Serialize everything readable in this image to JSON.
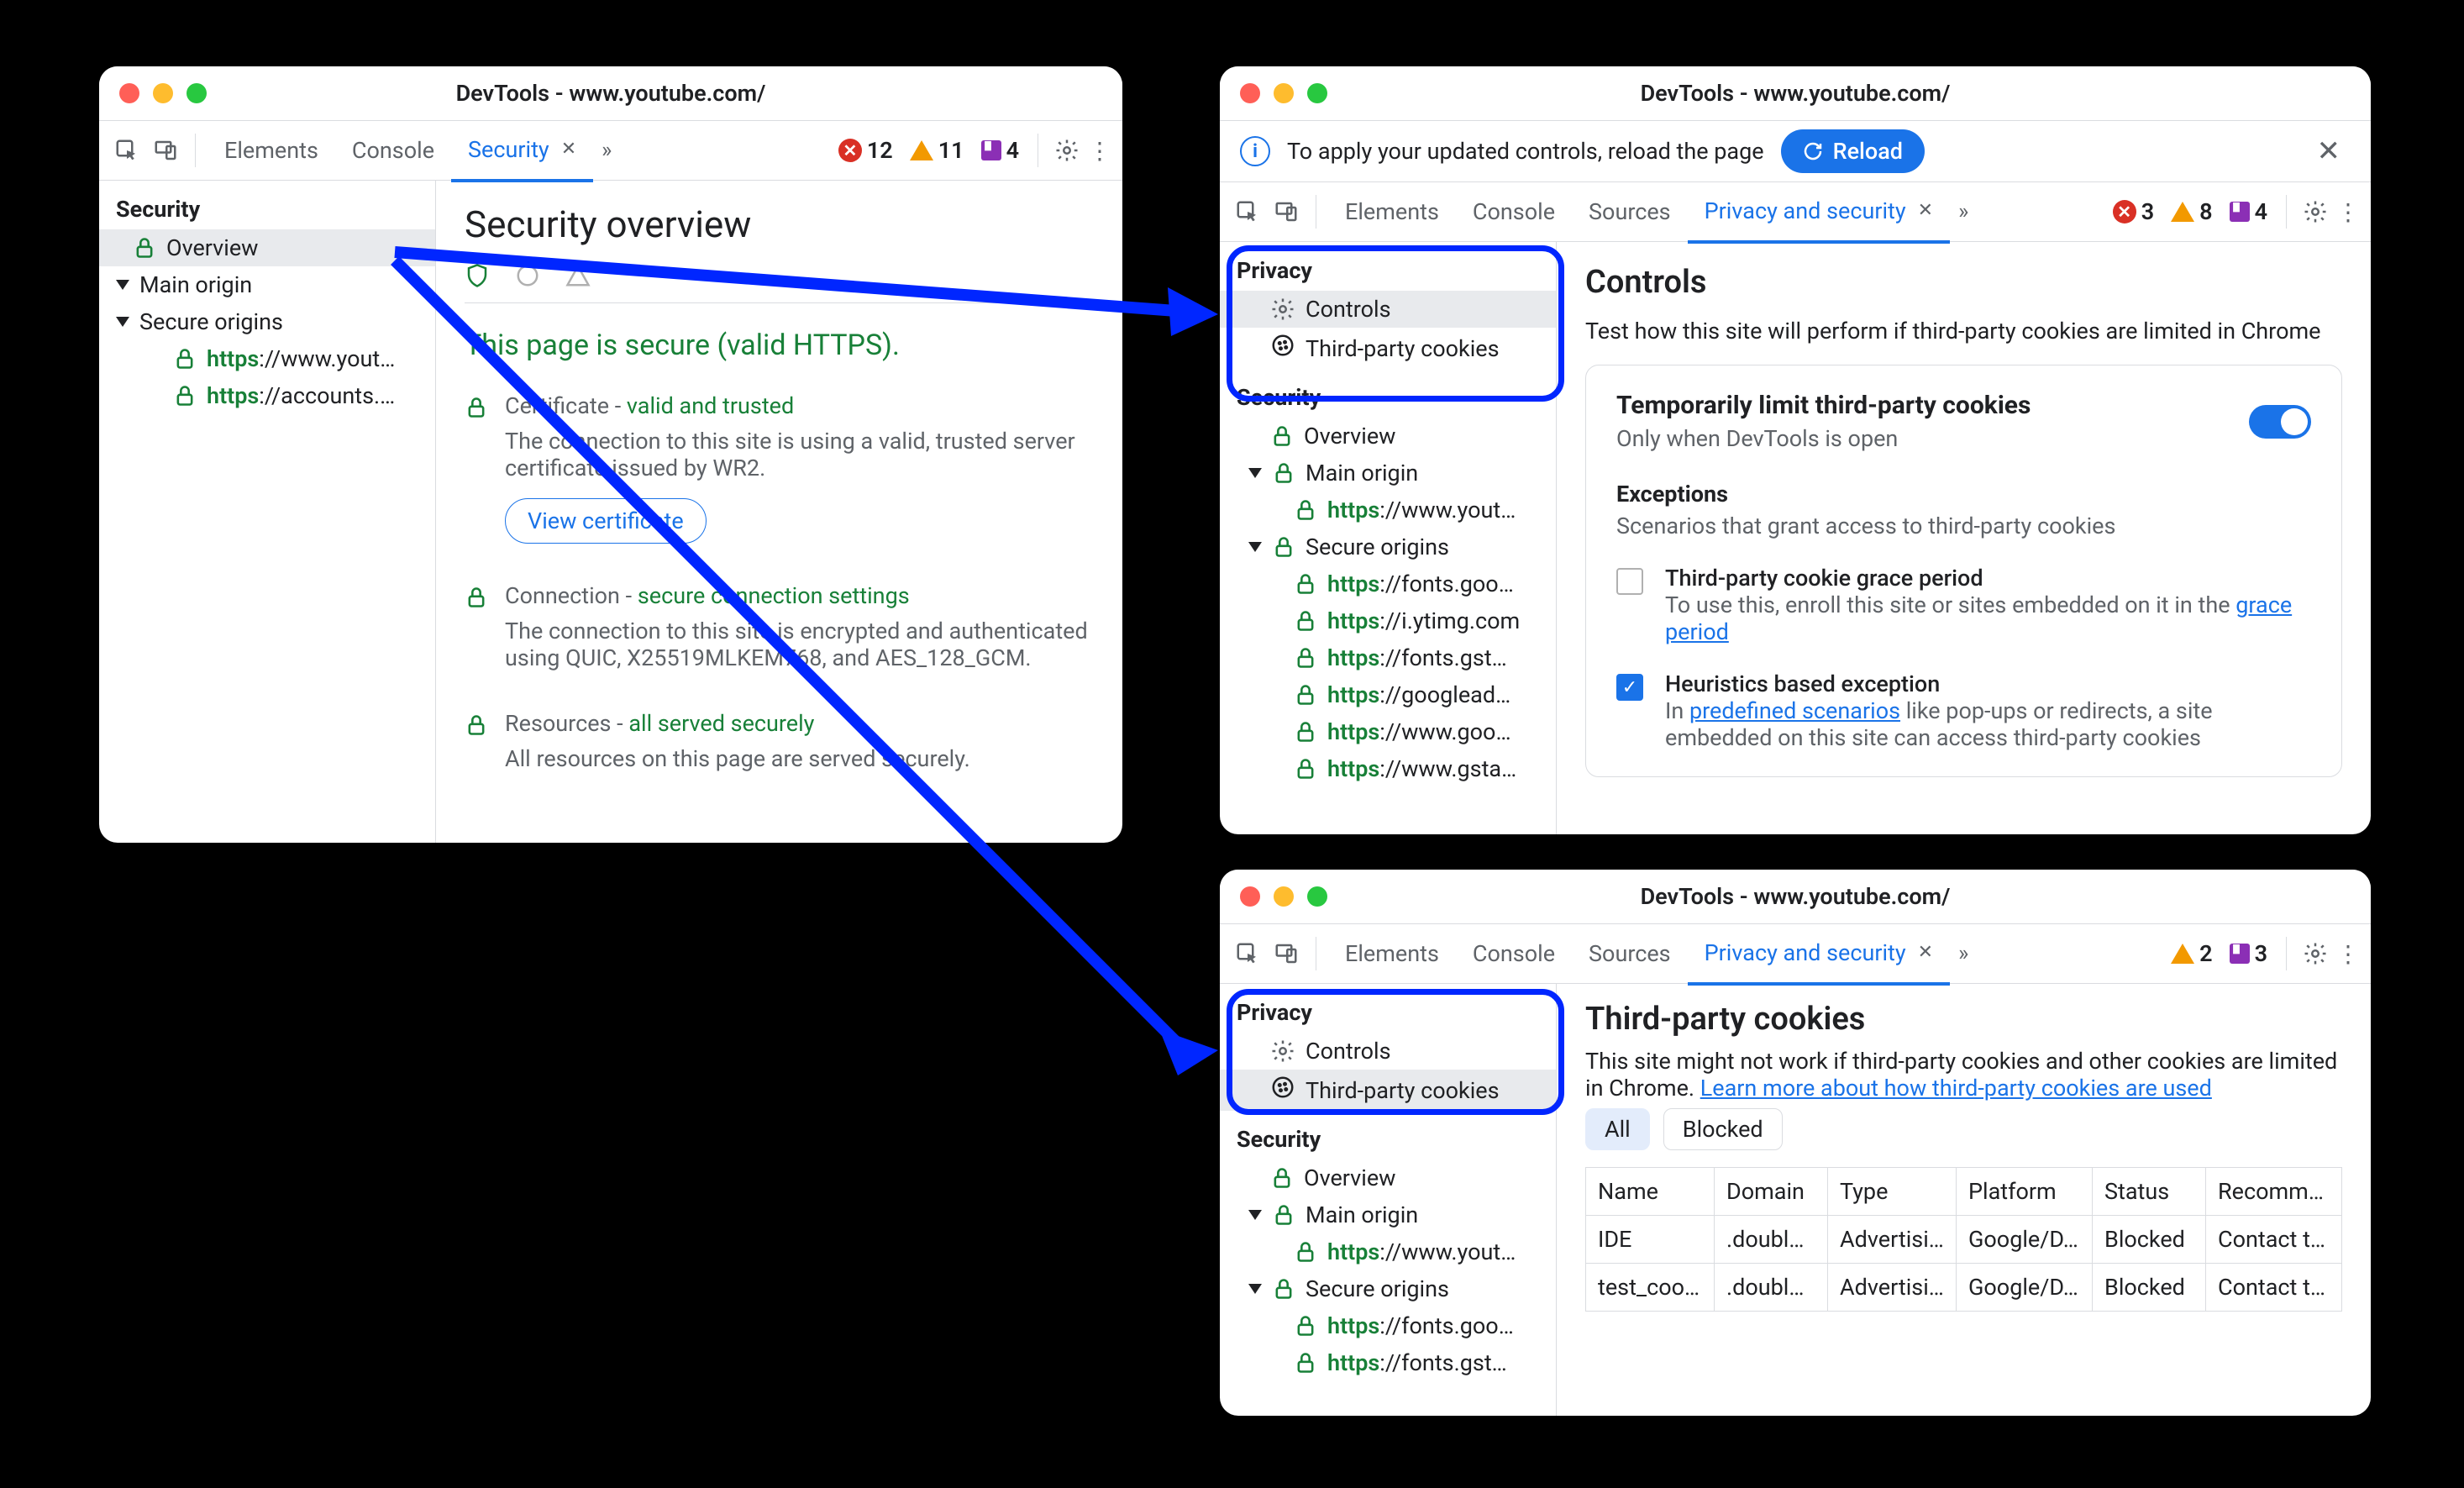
{
  "win1": {
    "title": "DevTools - www.youtube.com/",
    "tabs": [
      "Elements",
      "Console",
      "Security"
    ],
    "activeTab": 2,
    "counters": {
      "errors": 12,
      "warnings": 11,
      "issues": 4
    },
    "sidebar": {
      "group_security": "Security",
      "overview": "Overview",
      "main_origin": "Main origin",
      "secure_origins": "Secure origins",
      "origins": [
        "https://www.yout…",
        "https://accounts.…"
      ]
    },
    "main": {
      "heading": "Security overview",
      "headline": "This page is secure (valid HTTPS).",
      "cert_label": "Certificate - ",
      "cert_status": "valid and trusted",
      "cert_desc": "The connection to this site is using a valid, trusted server certificate issued by WR2.",
      "view_cert": "View certificate",
      "conn_label": "Connection - ",
      "conn_status": "secure connection settings",
      "conn_desc": "The connection to this site is encrypted and authenticated using QUIC, X25519MLKEM768, and AES_128_GCM.",
      "res_label": "Resources - ",
      "res_status": "all served securely",
      "res_desc": "All resources on this page are served securely."
    }
  },
  "win2": {
    "title": "DevTools - www.youtube.com/",
    "infobar": "To apply your updated controls, reload the page",
    "reload": "Reload",
    "tabs": [
      "Elements",
      "Console",
      "Sources",
      "Privacy and security"
    ],
    "activeTab": 3,
    "counters": {
      "errors": 3,
      "warnings": 8,
      "issues": 4
    },
    "sidebar": {
      "group_privacy": "Privacy",
      "controls": "Controls",
      "tpc": "Third-party cookies",
      "group_security": "Security",
      "overview": "Overview",
      "main_origin": "Main origin",
      "main_origin_url": "https://www.yout…",
      "secure_origins": "Secure origins",
      "urls": [
        "https://fonts.goo…",
        "https://i.ytimg.com",
        "https://fonts.gst…",
        "https://googlead…",
        "https://www.goo…",
        "https://www.gsta…"
      ]
    },
    "main": {
      "heading": "Controls",
      "subtitle": "Test how this site will perform if third-party cookies are limited in Chrome",
      "card_title": "Temporarily limit third-party cookies",
      "card_sub": "Only when DevTools is open",
      "exc_head": "Exceptions",
      "exc_sub": "Scenarios that grant access to third-party cookies",
      "row1_title": "Third-party cookie grace period",
      "row1_body_a": "To use this, enroll this site or sites embedded on it in the ",
      "row1_link": "grace period",
      "row2_title": "Heuristics based exception",
      "row2_body_a": "In ",
      "row2_link": "predefined scenarios",
      "row2_body_b": " like pop-ups or redirects, a site embedded on this site can access third-party cookies"
    }
  },
  "win3": {
    "title": "DevTools - www.youtube.com/",
    "tabs": [
      "Elements",
      "Console",
      "Sources",
      "Privacy and security"
    ],
    "activeTab": 3,
    "counters": {
      "warnings": 2,
      "issues": 3
    },
    "sidebar": {
      "group_privacy": "Privacy",
      "controls": "Controls",
      "tpc": "Third-party cookies",
      "group_security": "Security",
      "overview": "Overview",
      "main_origin": "Main origin",
      "main_origin_url": "https://www.yout…",
      "secure_origins": "Secure origins",
      "urls": [
        "https://fonts.goo…",
        "https://fonts.gst…"
      ]
    },
    "main": {
      "heading": "Third-party cookies",
      "desc_a": "This site might not work if third-party cookies and other cookies are limited in Chrome. ",
      "desc_link": "Learn more about how third-party cookies are used",
      "chip_all": "All",
      "chip_blocked": "Blocked",
      "cols": [
        "Name",
        "Domain",
        "Type",
        "Platform",
        "Status",
        "Recomm…"
      ],
      "rows": [
        {
          "name": "IDE",
          "domain": ".double…",
          "type": "Advertisi…",
          "platform": "Google/D…",
          "status": "Blocked",
          "rec": "Contact t…"
        },
        {
          "name": "test_cookie",
          "domain": ".double…",
          "type": "Advertisi…",
          "platform": "Google/D…",
          "status": "Blocked",
          "rec": "Contact t…"
        }
      ]
    }
  }
}
